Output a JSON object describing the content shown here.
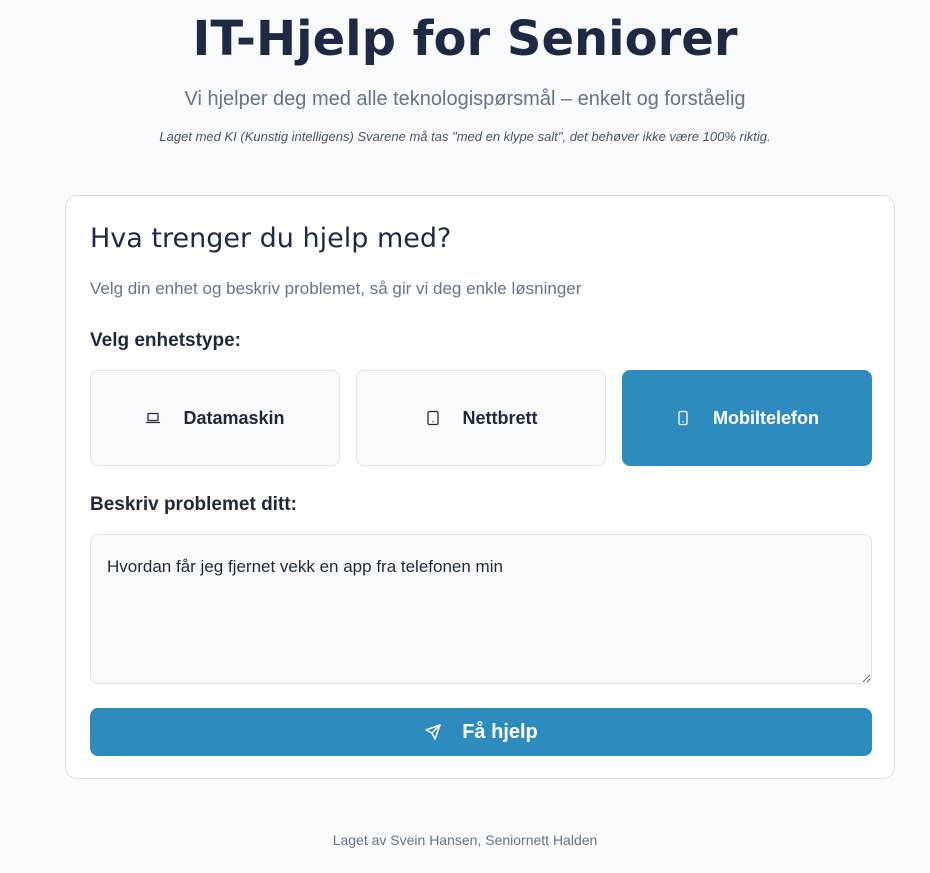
{
  "header": {
    "title": "IT-Hjelp for Seniorer",
    "subtitle": "Vi hjelper deg med alle teknologispørsmål – enkelt og forståelig",
    "note": "Laget med KI (Kunstig intelligens) Svarene må tas \"med en klype salt\", det behøver ikke være 100% riktig."
  },
  "card": {
    "title": "Hva trenger du hjelp med?",
    "subtitle": "Velg din enhet og beskriv problemet, så gir vi deg enkle løsninger",
    "device_label": "Velg enhetstype:",
    "devices": [
      {
        "label": "Datamaskin",
        "icon": "laptop-icon",
        "selected": false
      },
      {
        "label": "Nettbrett",
        "icon": "tablet-icon",
        "selected": false
      },
      {
        "label": "Mobiltelefon",
        "icon": "smartphone-icon",
        "selected": true
      }
    ],
    "problem_label": "Beskriv problemet ditt:",
    "problem_value": "Hvordan får jeg fjernet vekk en app fra telefonen min",
    "submit_label": "Få hjelp",
    "submit_icon": "send-icon"
  },
  "footer": {
    "text": "Laget av Svein Hansen, Seniornett Halden"
  },
  "colors": {
    "accent": "#2e8bbd",
    "title": "#1e2a44",
    "muted": "#64748b",
    "background": "#f8fafc"
  }
}
